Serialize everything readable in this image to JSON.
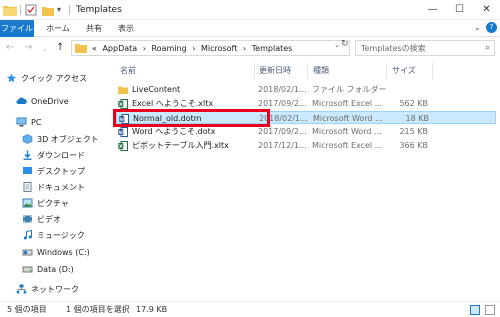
{
  "window": {
    "title": "Templates",
    "minimize": "—",
    "maximize": "☐",
    "close": "✕"
  },
  "ribbon": {
    "tabs": [
      "ファイル",
      "ホーム",
      "共有",
      "表示"
    ],
    "expand": "⌄",
    "help": "?"
  },
  "nav": {
    "back": "←",
    "forward": "→",
    "recent": "⌄",
    "up": "↑",
    "breadcrumb": [
      "«",
      "AppData",
      "›",
      "Roaming",
      "›",
      "Microsoft",
      "›",
      "Templates"
    ],
    "address_dropdown": "⌄",
    "refresh": "↻",
    "search_placeholder": "Templatesの検索",
    "search_icon": "⌕"
  },
  "sidebar": {
    "items": [
      {
        "label": "クイック アクセス",
        "icon": "star-icon"
      },
      {
        "label": "OneDrive",
        "icon": "cloud-icon"
      },
      {
        "label": "PC",
        "icon": "pc-icon"
      },
      {
        "label": "3D オブジェクト",
        "icon": "cube-icon"
      },
      {
        "label": "ダウンロード",
        "icon": "download-icon"
      },
      {
        "label": "デスクトップ",
        "icon": "desktop-icon"
      },
      {
        "label": "ドキュメント",
        "icon": "document-icon"
      },
      {
        "label": "ピクチャ",
        "icon": "picture-icon"
      },
      {
        "label": "ビデオ",
        "icon": "video-icon"
      },
      {
        "label": "ミュージック",
        "icon": "music-icon"
      },
      {
        "label": "Windows (C:)",
        "icon": "drive-icon"
      },
      {
        "label": "Data (D:)",
        "icon": "drive-icon"
      },
      {
        "label": "ネットワーク",
        "icon": "network-icon"
      }
    ]
  },
  "columns": {
    "name": "名前",
    "date": "更新日時",
    "type": "種類",
    "size": "サイズ"
  },
  "files": [
    {
      "name": "LiveContent",
      "date": "2018/02/1...",
      "type": "ファイル フォルダー",
      "size": "",
      "icon": "folder-icon"
    },
    {
      "name": "Excel へようこそ.xltx",
      "date": "2017/09/2...",
      "type": "Microsoft Excel ...",
      "size": "562 KB",
      "icon": "excel-icon"
    },
    {
      "name": "Normal_old.dotm",
      "date": "2018/02/1...",
      "type": "Microsoft Word ...",
      "size": "18 KB",
      "icon": "word-icon"
    },
    {
      "name": "Word へようこそ.dotx",
      "date": "2017/09/2...",
      "type": "Microsoft Word ...",
      "size": "215 KB",
      "icon": "word-icon"
    },
    {
      "name": "ピボットテーブル入門.xltx",
      "date": "2017/12/1...",
      "type": "Microsoft Excel ...",
      "size": "366 KB",
      "icon": "excel-icon"
    }
  ],
  "status": {
    "count": "5 個の項目",
    "selected": "1 個の項目を選択",
    "size": "17.9 KB"
  },
  "colors": {
    "accent": "#1979ca",
    "selection": "#cce8ff",
    "highlight": "#e8001c",
    "folder": "#f3c34b"
  }
}
